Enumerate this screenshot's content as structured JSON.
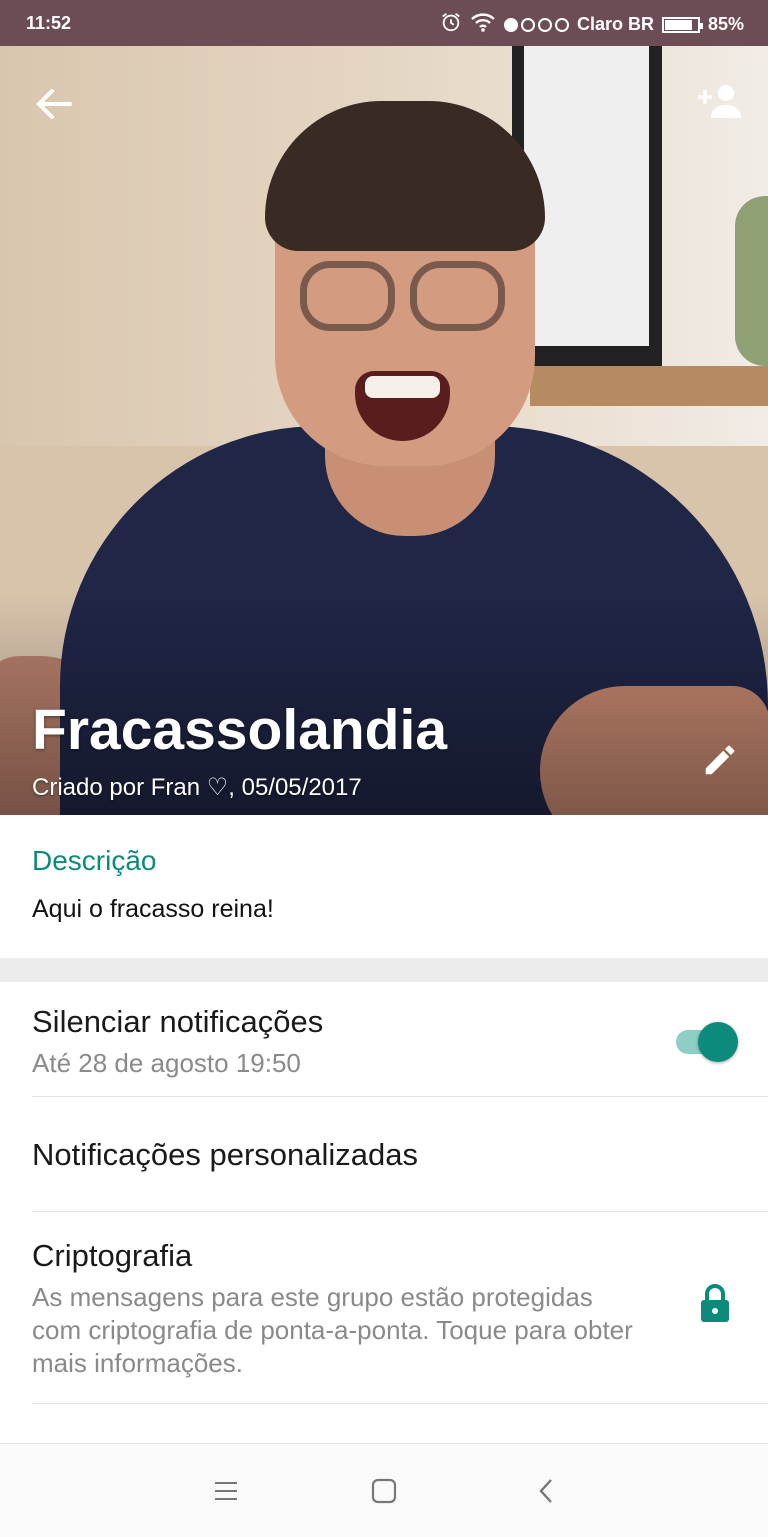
{
  "status_bar": {
    "time": "11:52",
    "carrier": "Claro BR",
    "battery": "85%",
    "battery_level": 0.85,
    "signal_bars_filled": 1,
    "signal_bars_total": 4,
    "icons": [
      "alarm-icon",
      "wifi-icon",
      "signal-icon",
      "battery-icon"
    ]
  },
  "header": {
    "group_name": "Fracassolandia",
    "created_by": "Criado por Fran ♡, 05/05/2017",
    "icons": {
      "back": "arrow-back-icon",
      "add": "add-participant-icon",
      "edit": "edit-pencil-icon"
    }
  },
  "description": {
    "label": "Descrição",
    "text": "Aqui o fracasso reina!"
  },
  "settings": {
    "mute": {
      "title": "Silenciar notificações",
      "subtitle": "Até 28 de agosto 19:50",
      "enabled": true
    },
    "custom_notifications": {
      "title": "Notificações personalizadas"
    },
    "encryption": {
      "title": "Criptografia",
      "subtitle": "As mensagens para este grupo estão protegidas com criptografia de ponta-a-ponta. Toque para obter mais informações.",
      "icon": "lock-icon"
    }
  },
  "navbar": {
    "icons": [
      "menu-icon",
      "home-icon",
      "back-icon"
    ]
  },
  "colors": {
    "accent": "#0c8b7c",
    "status_bar": "#6d4d55",
    "toggle_track": "#8dcfc5"
  }
}
